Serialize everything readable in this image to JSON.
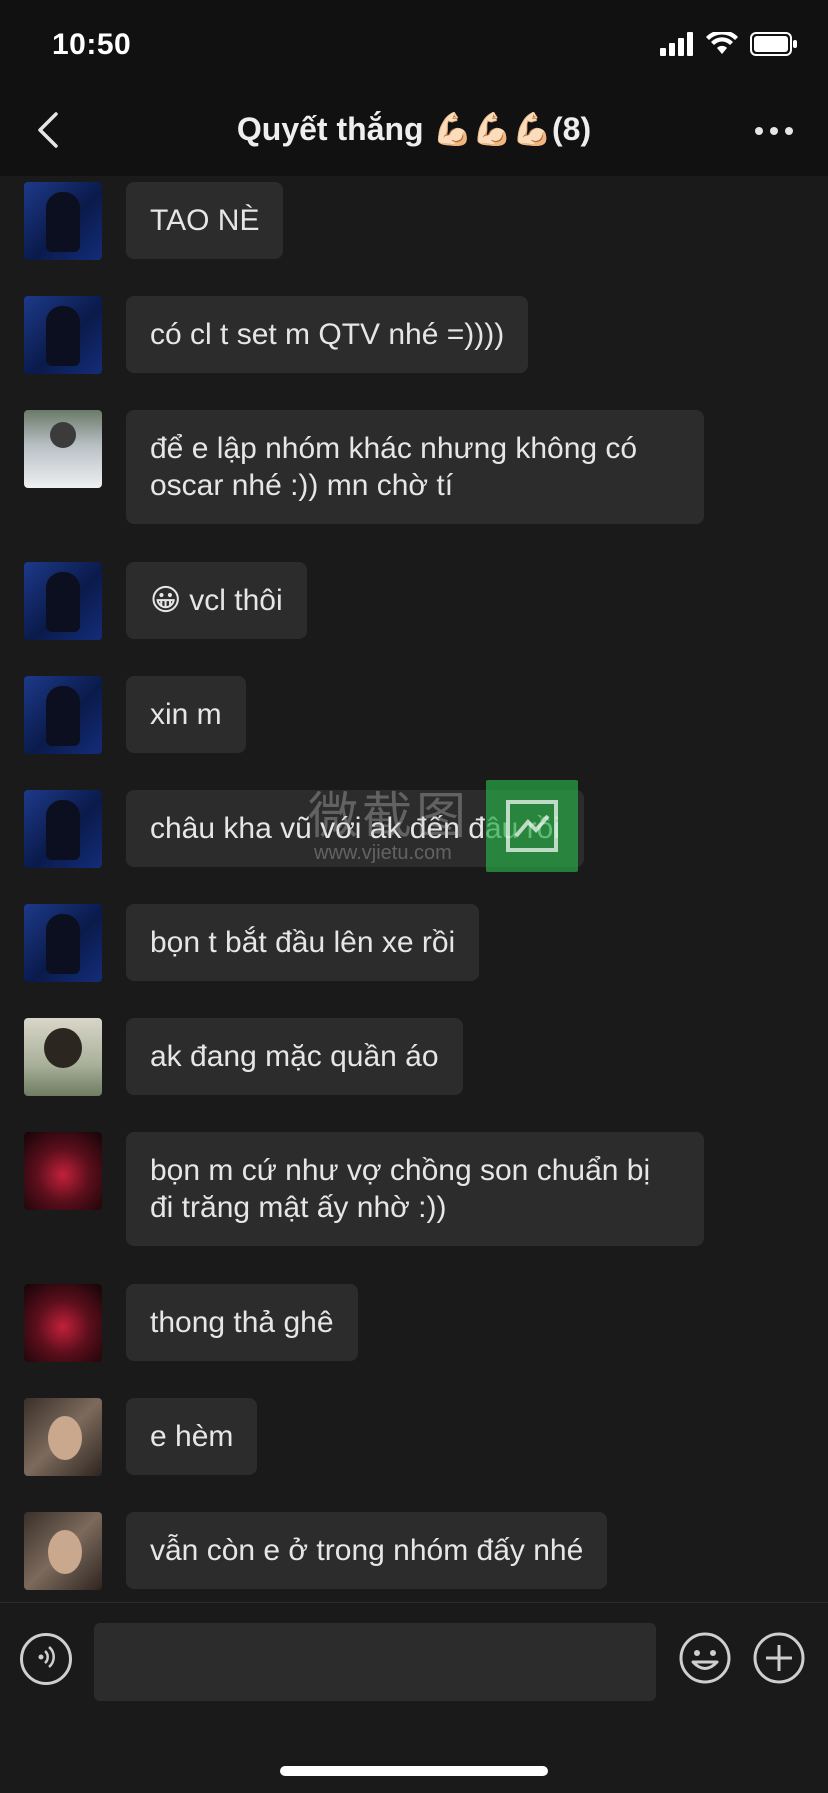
{
  "status_bar": {
    "time": "10:50"
  },
  "header": {
    "back_icon": "chevron-left-icon",
    "title": "Quyết thắng 💪🏻💪🏻💪🏻(8)",
    "more_icon": "more-horizontal-icon"
  },
  "messages": [
    {
      "avatar": "avatar-blue-dark",
      "text": "TAO NÈ"
    },
    {
      "avatar": "avatar-blue-dark",
      "text": "có cl t set m QTV nhé =))))"
    },
    {
      "avatar": "avatar-white-jacket",
      "text": "để e lập nhóm khác nhưng không có oscar nhé :)) mn chờ tí"
    },
    {
      "avatar": "avatar-blue-dark",
      "emoji": "😀",
      "text": "vcl thôi"
    },
    {
      "avatar": "avatar-blue-dark",
      "text": "xin m"
    },
    {
      "avatar": "avatar-blue-dark",
      "text": "châu kha vũ với ak đến đâu rồi"
    },
    {
      "avatar": "avatar-blue-dark",
      "text": "bọn t bắt đầu lên xe rồi"
    },
    {
      "avatar": "avatar-glasses",
      "text": "ak đang mặc quần áo"
    },
    {
      "avatar": "avatar-red",
      "text": "bọn m cứ như vợ chồng son chuẩn bị đi trăng mật ấy nhờ :))"
    },
    {
      "avatar": "avatar-red",
      "text": "thong thả ghê"
    },
    {
      "avatar": "avatar-portrait",
      "text": "e hèm"
    },
    {
      "avatar": "avatar-portrait",
      "text": "vẫn còn e ở trong nhóm đấy nhé"
    }
  ],
  "watermark": {
    "text": "微截图",
    "url": "www.vjietu.com"
  },
  "input_bar": {
    "voice_icon": "voice-icon",
    "input_value": "",
    "emoji_icon": "emoji-icon",
    "plus_icon": "plus-icon"
  }
}
